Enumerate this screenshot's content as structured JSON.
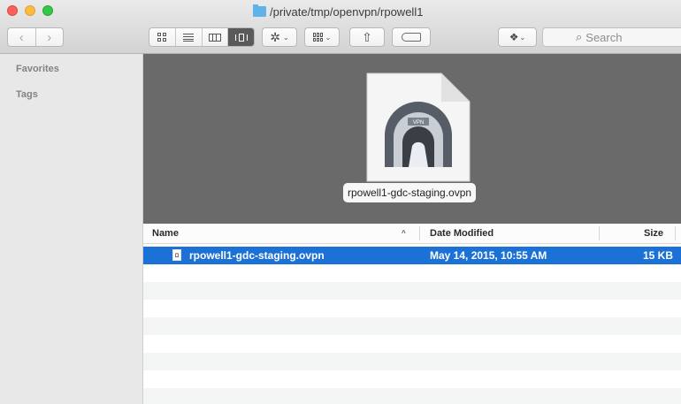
{
  "window": {
    "title": "/private/tmp/openvpn/rpowell1"
  },
  "toolbar": {
    "back_glyph": "‹",
    "forward_glyph": "›",
    "share_glyph": "⇧",
    "action_glyph": "✲",
    "dropbox_glyph": "❖",
    "caret_glyph": "⌄",
    "search_placeholder": "Search",
    "search_glyph": "⌕"
  },
  "sidebar": {
    "favorites_label": "Favorites",
    "tags_label": "Tags"
  },
  "preview": {
    "file_name": "rpowell1-gdc-staging.ovpn",
    "badge_text": "VPN"
  },
  "list": {
    "columns": {
      "name": "Name",
      "date_modified": "Date Modified",
      "size": "Size"
    },
    "sort_glyph": "^",
    "rows": [
      {
        "name": "rpowell1-gdc-staging.ovpn",
        "date_modified": "May 14, 2015, 10:55 AM",
        "size": "15 KB",
        "selected": true
      }
    ]
  },
  "colors": {
    "selection": "#1c71d6",
    "preview_bg": "#6a6a6a",
    "close": "#fc605c",
    "minimize": "#fdbc40",
    "zoom": "#34c84a"
  }
}
